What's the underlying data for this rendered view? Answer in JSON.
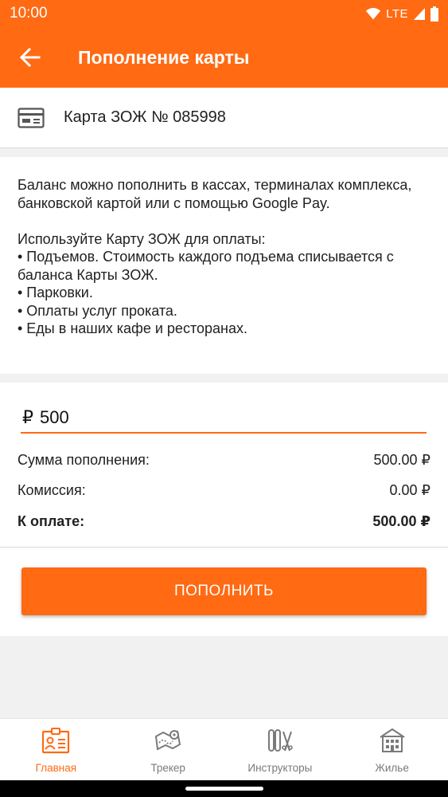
{
  "status_bar": {
    "time": "10:00",
    "network": "LTE"
  },
  "toolbar": {
    "title": "Пополнение карты",
    "back_icon": "arrow-back-icon"
  },
  "card": {
    "icon": "card-icon",
    "title": "Карта ЗОЖ № 085998"
  },
  "info": {
    "intro": "Баланс можно пополнить в кассах, терминалах комплекса, банковской картой или с помощью Google Pay.",
    "usage_header": "Используйте Карту ЗОЖ для оплаты:",
    "bullets": [
      "• Подъемов. Стоимость каждого подъема списывается с баланса Карты ЗОЖ.",
      "• Парковки.",
      "• Оплаты услуг проката.",
      "• Еды в наших кафе и ресторанах."
    ]
  },
  "payment": {
    "currency_symbol": "₽",
    "amount_value": "500",
    "rows": [
      {
        "label": "Сумма пополнения:",
        "value": "500.00 ₽"
      },
      {
        "label": "Комиссия:",
        "value": "0.00 ₽"
      },
      {
        "label": "К оплате:",
        "value": "500.00 ₽"
      }
    ],
    "button_label": "ПОПОЛНИТЬ"
  },
  "bottom_nav": {
    "items": [
      {
        "label": "Главная",
        "icon": "id-card-icon",
        "active": true
      },
      {
        "label": "Трекер",
        "icon": "map-route-icon",
        "active": false
      },
      {
        "label": "Инструкторы",
        "icon": "ski-equipment-icon",
        "active": false
      },
      {
        "label": "Жилье",
        "icon": "building-icon",
        "active": false
      }
    ]
  },
  "colors": {
    "accent": "#ff6a13",
    "inactive": "#7a7a7a",
    "background": "#f1f1f1"
  }
}
